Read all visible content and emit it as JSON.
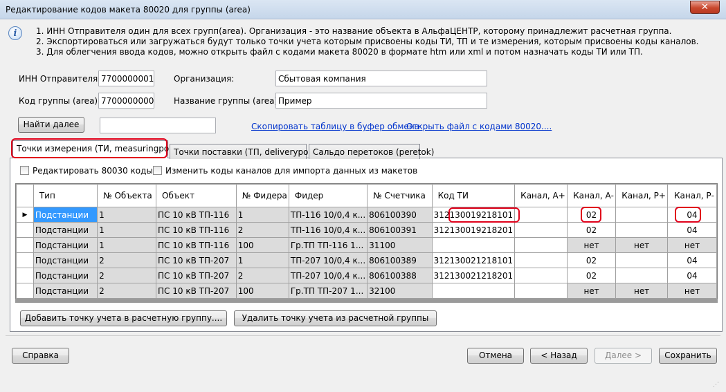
{
  "window": {
    "title": "Редактирование кодов макета 80020 для группы (area)",
    "close_glyph": "✕"
  },
  "info": {
    "icon": "i",
    "lines": [
      "1. ИНН Отправителя один для всех групп(area). Организация - это название объекта в АльфаЦЕНТР, которому принадлежит расчетная группа.",
      "2. Экспортироваться или загружаться будут только точки учета которым присвоены коды ТИ, ТП и те измерения, которым присвоены коды каналов.",
      "3. Для облегчения ввода кодов, можно открыть файл с кодами макета 80020 в формате htm или xml и потом назначать коды ТИ или ТП."
    ]
  },
  "form": {
    "inn_label": "ИНН Отправителя:",
    "inn_value": "7700000001",
    "org_label": "Организация:",
    "org_value": "Сбытовая компания",
    "area_code_label": "Код группы (area):",
    "area_code_value": "7700000000",
    "area_name_label": "Название группы (area):",
    "area_name_value": "Пример",
    "find_next_label": "Найти далее",
    "find_value": "",
    "copy_link": "Скопировать таблицу в буфер обмена",
    "open_link": "Открыть файл с кодами 80020...."
  },
  "tabs": [
    {
      "label": "Точки измерения (ТИ, measuringpoint)",
      "active": true
    },
    {
      "label": "Точки поставки (ТП, deliverypoint)",
      "active": false
    },
    {
      "label": "Сальдо перетоков (peretok)",
      "active": false
    }
  ],
  "options": {
    "edit_80030_label": "Редактировать 80030 коды",
    "change_codes_label": "Изменить коды каналов для импорта данных из макетов"
  },
  "table": {
    "columns": [
      "Тип",
      "№ Объекта",
      "Объект",
      "№ Фидера",
      "Фидер",
      "№ Счетчика",
      "Код ТИ",
      "Канал, А+",
      "Канал, А-",
      "Канал, Р+",
      "Канал, Р-"
    ],
    "current_row_marker": "▶",
    "rows": [
      [
        "Подстанции",
        "1",
        "ПС 10 кВ ТП-116",
        "1",
        "ТП-116 10/0,4 к...",
        "806100390",
        "312130019218101",
        "",
        "02",
        "",
        "04"
      ],
      [
        "Подстанции",
        "1",
        "ПС 10 кВ ТП-116",
        "2",
        "ТП-116 10/0,4 к...",
        "806100391",
        "312130019218201",
        "",
        "02",
        "",
        "04"
      ],
      [
        "Подстанции",
        "1",
        "ПС 10 кВ ТП-116",
        "100",
        "Гр.ТП ТП-116 1...",
        "31100",
        "",
        "",
        "нет",
        "нет",
        "нет"
      ],
      [
        "Подстанции",
        "2",
        "ПС 10 кВ ТП-207",
        "1",
        "ТП-207 10/0,4 к...",
        "806100389",
        "312130021218101",
        "",
        "02",
        "",
        "04"
      ],
      [
        "Подстанции",
        "2",
        "ПС 10 кВ ТП-207",
        "2",
        "ТП-207 10/0,4 к...",
        "806100388",
        "312130021218201",
        "",
        "02",
        "",
        "04"
      ],
      [
        "Подстанции",
        "2",
        "ПС 10 кВ ТП-207",
        "100",
        "Гр.ТП ТП-207 1...",
        "32100",
        "",
        "",
        "нет",
        "нет",
        "нет"
      ]
    ]
  },
  "actions": {
    "add_point_label": "Добавить точку учета в расчетную группу....",
    "remove_point_label": "Удалить точку учета из расчетной группы",
    "help_label": "Справка",
    "cancel_label": "Отмена",
    "back_label": "< Назад",
    "next_label": "Далее >",
    "save_label": "Сохранить"
  },
  "colors": {
    "selection": "#3399ff",
    "highlight": "#e0001a",
    "link": "#0033cc"
  }
}
